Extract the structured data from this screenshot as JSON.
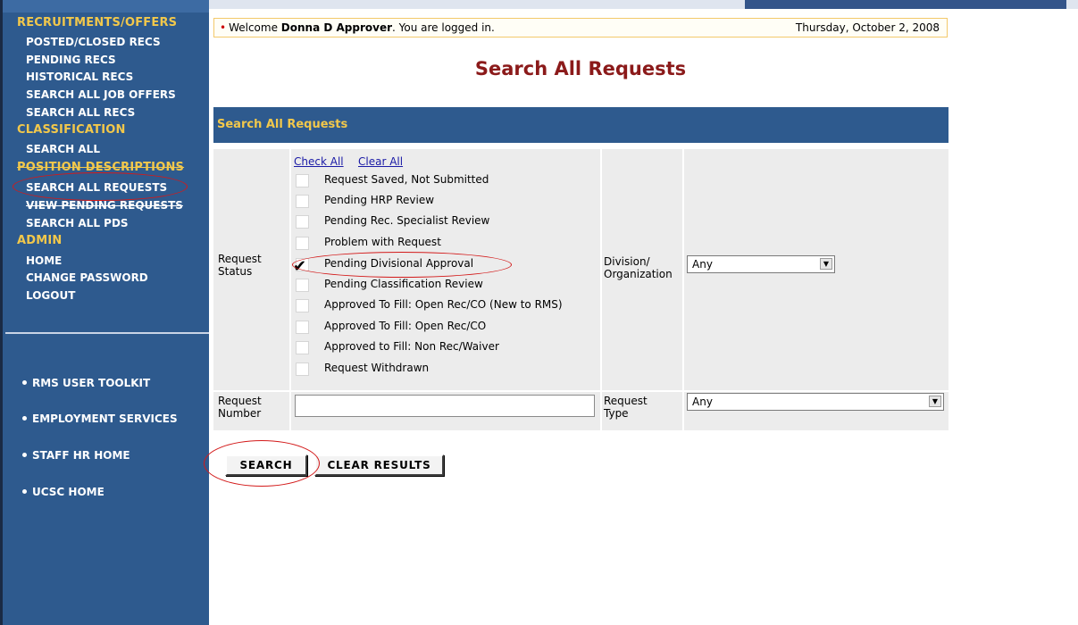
{
  "welcome": {
    "greeting_prefix": "Welcome",
    "user_name": "Donna D Approver",
    "greeting_suffix": ". You are logged in.",
    "date": "Thursday, October 2, 2008"
  },
  "page_title": "Search All Requests",
  "panel_title": "Search All Requests",
  "sidebar": {
    "sections": [
      {
        "title": "RECRUITMENTS/OFFERS",
        "items": [
          "POSTED/CLOSED RECS",
          "PENDING RECS",
          "HISTORICAL RECS",
          "SEARCH ALL JOB OFFERS",
          "SEARCH ALL RECS"
        ]
      },
      {
        "title": "CLASSIFICATION",
        "items": [
          "SEARCH ALL"
        ]
      },
      {
        "title": "POSITION DESCRIPTIONS",
        "items": [
          "SEARCH ALL REQUESTS",
          "VIEW PENDING REQUESTS",
          "SEARCH ALL PDS"
        ]
      },
      {
        "title": "ADMIN",
        "items": [
          "HOME",
          "CHANGE PASSWORD",
          "LOGOUT"
        ]
      }
    ],
    "external_links": [
      "RMS USER TOOLKIT",
      "EMPLOYMENT SERVICES",
      "STAFF HR HOME",
      "UCSC HOME"
    ]
  },
  "form": {
    "request_status_label": "Request Status",
    "check_all": "Check All",
    "clear_all": "Clear All",
    "statuses": [
      {
        "label": "Request Saved, Not Submitted",
        "checked": false
      },
      {
        "label": "Pending HRP Review",
        "checked": false
      },
      {
        "label": "Pending Rec. Specialist Review",
        "checked": false
      },
      {
        "label": "Problem with Request",
        "checked": false
      },
      {
        "label": "Pending Divisional Approval",
        "checked": true
      },
      {
        "label": "Pending Classification Review",
        "checked": false
      },
      {
        "label": "Approved To Fill: Open Rec/CO (New to RMS)",
        "checked": false
      },
      {
        "label": "Approved To Fill: Open Rec/CO",
        "checked": false
      },
      {
        "label": "Approved to Fill: Non Rec/Waiver",
        "checked": false
      },
      {
        "label": "Request Withdrawn",
        "checked": false
      }
    ],
    "division_label": "Division/ Organization",
    "division_value": "Any",
    "request_number_label": "Request Number",
    "request_number_value": "",
    "request_type_label": "Request Type",
    "request_type_value": "Any"
  },
  "buttons": {
    "search": "SEARCH",
    "clear_results": "CLEAR RESULTS"
  },
  "colors": {
    "sidebar_bg": "#2e5a8e",
    "section_title": "#f2c84b",
    "page_title": "#8b1a1a",
    "annotation": "#d31a1a"
  }
}
